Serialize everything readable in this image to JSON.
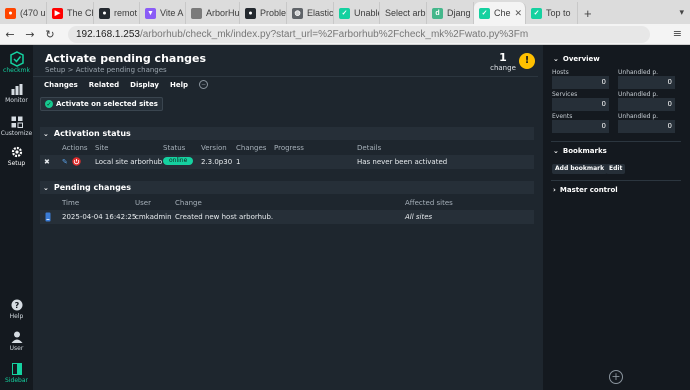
{
  "browser": {
    "tabs": [
      {
        "label": "(470 u",
        "fav": "reddit-icon",
        "color": "#ff4500"
      },
      {
        "label": "The Ch",
        "fav": "youtube-icon",
        "color": "#ff0000"
      },
      {
        "label": "remot",
        "fav": "github-icon",
        "color": "#24292f"
      },
      {
        "label": "Vite A",
        "fav": "vite-icon",
        "color": "#8a5cf6"
      },
      {
        "label": "ArborHub",
        "fav": "page-icon",
        "color": "#7a7a7a"
      },
      {
        "label": "Proble",
        "fav": "github-icon",
        "color": "#24292f"
      },
      {
        "label": "Elastic",
        "fav": "globe-icon",
        "color": "#5f6368"
      },
      {
        "label": "Unable",
        "fav": "checkmk-icon",
        "color": "#15d1a0"
      },
      {
        "label": "Select arb",
        "fav": "blank-icon",
        "color": "#dcdcdc"
      },
      {
        "label": "Djang",
        "fav": "django-icon",
        "color": "#44b78b"
      },
      {
        "label": "Che",
        "fav": "checkmk-icon",
        "color": "#15d1a0"
      },
      {
        "label": "Top to",
        "fav": "checkmk-icon",
        "color": "#15d1a0"
      }
    ],
    "url_host": "192.168.1.253",
    "url_path": "/arborhub/check_mk/index.py?start_url=%2Farborhub%2Fcheck_mk%2Fwato.py%3Fm"
  },
  "leftnav": {
    "logo_text": "checkmk",
    "monitor": "Monitor",
    "customize": "Customize",
    "setup": "Setup",
    "help": "Help",
    "user": "User",
    "sidebar": "Sidebar"
  },
  "page": {
    "title": "Activate pending changes",
    "breadcrumb": "Setup > Activate pending changes",
    "change_count": "1",
    "change_label": "change",
    "warning_symbol": "!"
  },
  "menu": {
    "changes": "Changes",
    "related": "Related",
    "display": "Display",
    "help": "Help"
  },
  "activate_button": "Activate on selected sites",
  "activation_status": {
    "heading": "Activation status",
    "columns": {
      "actions": "Actions",
      "site": "Site",
      "status": "Status",
      "version": "Version",
      "changes": "Changes",
      "progress": "Progress",
      "details": "Details"
    },
    "row": {
      "site": "Local site arborhub",
      "status": "online",
      "version": "2.3.0p30",
      "changes": "1",
      "details": "Has never been activated"
    }
  },
  "pending_changes": {
    "heading": "Pending changes",
    "columns": {
      "time": "Time",
      "user": "User",
      "change": "Change",
      "affected": "Affected sites"
    },
    "row": {
      "time": "2025-04-04 16:42:25",
      "user": "cmkadmin",
      "change": "Created new host arborhub.",
      "affected": "All sites"
    }
  },
  "sidebar": {
    "overview": {
      "heading": "Overview",
      "rows": [
        {
          "left_label": "Hosts",
          "left_value": "0",
          "right_label": "Unhandled p.",
          "right_value": "0"
        },
        {
          "left_label": "Services",
          "left_value": "0",
          "right_label": "Unhandled p.",
          "right_value": "0"
        },
        {
          "left_label": "Events",
          "left_value": "0",
          "right_label": "Unhandled p.",
          "right_value": "0"
        }
      ]
    },
    "bookmarks": {
      "heading": "Bookmarks",
      "add": "Add bookmark",
      "edit": "Edit"
    },
    "master_control": {
      "heading": "Master control"
    }
  },
  "colors": {
    "accent": "#15d1a0",
    "warning": "#ffc000"
  }
}
